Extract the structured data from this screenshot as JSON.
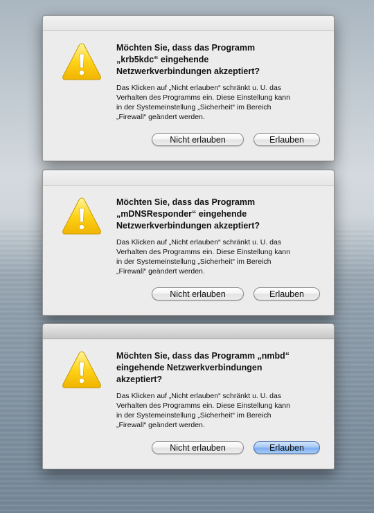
{
  "dialogs": [
    {
      "title": "Möchten Sie, dass das Programm\n„krb5kdc“ eingehende\nNetzwerkverbindungen akzeptiert?",
      "body": "Das Klicken auf „Nicht erlauben“ schränkt u. U. das\nVerhalten des Programms ein. Diese Einstellung kann\nin der Systemeinstellung „Sicherheit“ im Bereich\n„Firewall“ geändert werden.",
      "deny_label": "Nicht erlauben",
      "allow_label": "Erlauben",
      "icon": "warning-icon",
      "active": false
    },
    {
      "title": "Möchten Sie, dass das Programm\n„mDNSResponder“ eingehende\nNetzwerkverbindungen akzeptiert?",
      "body": "Das Klicken auf „Nicht erlauben“ schränkt u. U. das\nVerhalten des Programms ein. Diese Einstellung kann\nin der Systemeinstellung „Sicherheit“ im Bereich\n„Firewall“ geändert werden.",
      "deny_label": "Nicht erlauben",
      "allow_label": "Erlauben",
      "icon": "warning-icon",
      "active": false
    },
    {
      "title": "Möchten Sie, dass das Programm „nmbd“\neingehende Netzwerkverbindungen\nakzeptiert?",
      "body": "Das Klicken auf „Nicht erlauben“ schränkt u. U. das\nVerhalten des Programms ein. Diese Einstellung kann\nin der Systemeinstellung „Sicherheit“ im Bereich\n„Firewall“ geändert werden.",
      "deny_label": "Nicht erlauben",
      "allow_label": "Erlauben",
      "icon": "warning-icon",
      "active": true
    }
  ],
  "colors": {
    "default_button": "#7eaef0",
    "warning_yellow": "#ffd21a",
    "dialog_bg": "#ececec"
  }
}
